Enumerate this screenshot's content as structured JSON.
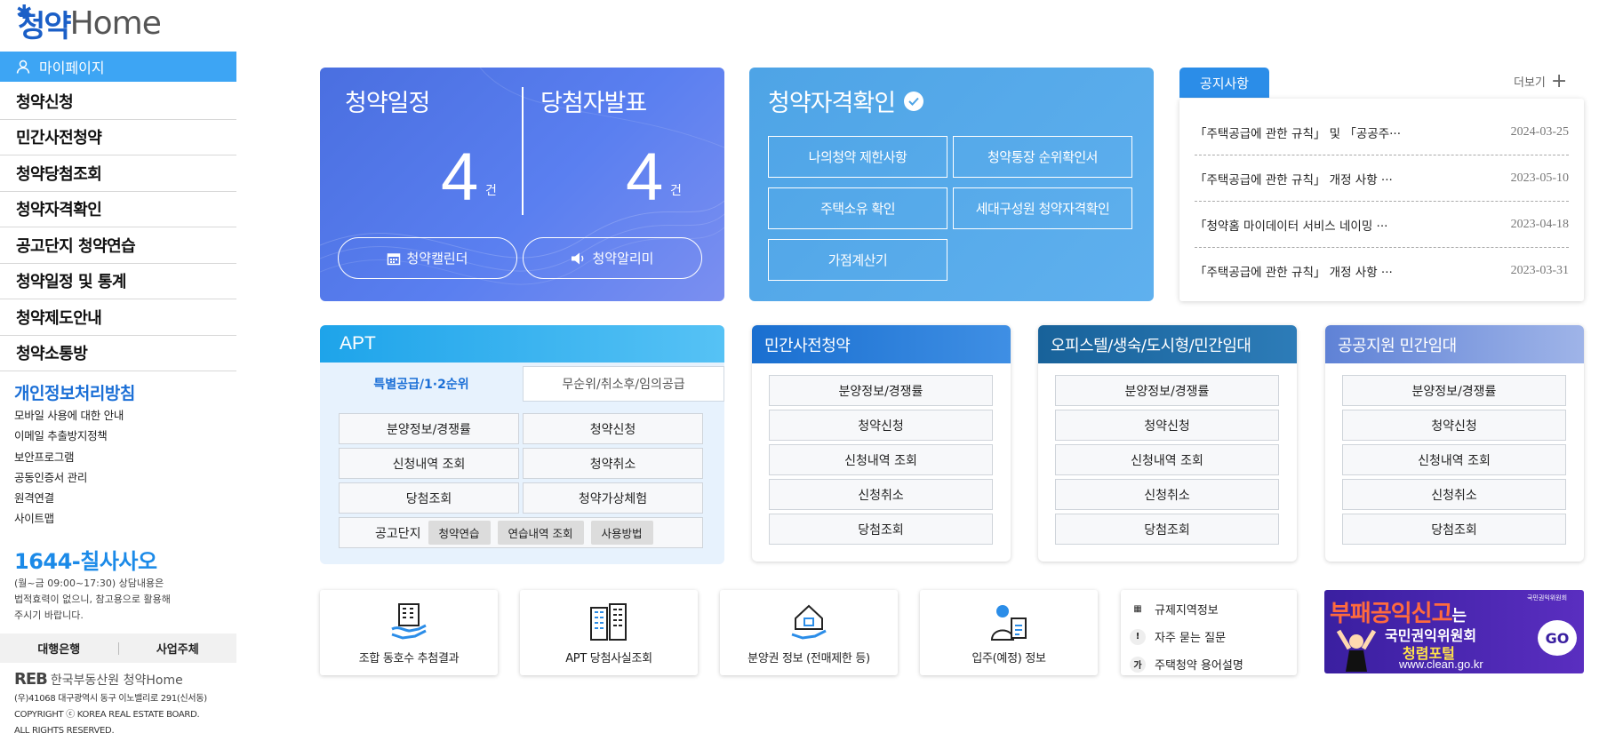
{
  "logo": {
    "ko": "청약",
    "en": "Home"
  },
  "sidebar": {
    "mypage": "마이페이지",
    "nav": [
      "청약신청",
      "민간사전청약",
      "청약당첨조회",
      "청약자격확인",
      "공고단지 청약연습",
      "청약일정 및 통계",
      "청약제도안내",
      "청약소통방"
    ],
    "privacy_title": "개인정보처리방침",
    "links": [
      "모바일 사용에 대한 안내",
      "이메일 추출방지정책",
      "보안프로그램",
      "공동인증서 관리",
      "원격연결",
      "사이트맵"
    ],
    "phone": "1644-칠사사오",
    "phone_note": [
      "(월~금 09:00~17:30) 상담내용은",
      "법적효력이 없으니, 참고용으로 활용해",
      "주시기 바랍니다."
    ],
    "bank": "대행은행",
    "business": "사업주체",
    "reb_logo": "REB",
    "reb_text": "한국부동산원 청약Home",
    "address": [
      "(우)41068 대구광역시 동구 이노밸리로 291(신서동)",
      "COPYRIGHT ⓒ KOREA REAL ESTATE BOARD.",
      "ALL RIGHTS RESERVED."
    ]
  },
  "schedule": {
    "title_left": "청약일정",
    "title_right": "당첨자발표",
    "count_left": "4",
    "count_right": "4",
    "unit": "건",
    "calendar_btn": "청약캘린더",
    "alarm_btn": "청약알리미"
  },
  "qualification": {
    "title": "청약자격확인",
    "buttons": [
      "나의청약 제한사항",
      "청약통장 순위확인서",
      "주택소유 확인",
      "세대구성원 청약자격확인",
      "가점계산기"
    ]
  },
  "notice": {
    "tab": "공지사항",
    "more": "더보기",
    "items": [
      {
        "title": "「주택공급에 관한 규칙」 및 「공공주···",
        "date": "2024-03-25"
      },
      {
        "title": "「주택공급에 관한 규칙」 개정 사항 ···",
        "date": "2023-05-10"
      },
      {
        "title": "「청약홈 마이데이터 서비스 네이밍 ···",
        "date": "2023-04-18"
      },
      {
        "title": "「주택공급에 관한 규칙」 개정 사항 ···",
        "date": "2023-03-31"
      }
    ]
  },
  "apt": {
    "title": "APT",
    "tab_active": "특별공급/1·2순위",
    "tab_inactive": "무순위/취소후/임의공급",
    "buttons": [
      "분양정보/경쟁률",
      "청약신청",
      "신청내역 조회",
      "청약취소",
      "당첨조회",
      "청약가상체험"
    ],
    "practice_label": "공고단지",
    "practice_chips": [
      "청약연습",
      "연습내역 조회",
      "사용방법"
    ]
  },
  "panels": [
    {
      "title": "민간사전청약",
      "buttons": [
        "분양정보/경쟁률",
        "청약신청",
        "신청내역 조회",
        "신청취소",
        "당첨조회"
      ]
    },
    {
      "title": "오피스텔/생숙/도시형/민간임대",
      "buttons": [
        "분양정보/경쟁률",
        "청약신청",
        "신청내역 조회",
        "신청취소",
        "당첨조회"
      ]
    },
    {
      "title": "공공지원 민간임대",
      "buttons": [
        "분양정보/경쟁률",
        "청약신청",
        "신청내역 조회",
        "신청취소",
        "당첨조회"
      ]
    }
  ],
  "quick": [
    "조합 동호수 추첨결과",
    "APT 당첨사실조회",
    "분양권 정보 (전매제한 등)",
    "입주(예정) 정보"
  ],
  "mini": [
    "규제지역정보",
    "자주 묻는 질문",
    "주택청약 용어설명"
  ],
  "banner": {
    "title": "부패공익신고",
    "suffix": "는",
    "org": "국민권익위원회",
    "portal": "청렴포털",
    "url": "www.clean.go.kr",
    "go": "GO",
    "badge": "국민권익위원회"
  },
  "colors": {
    "accent": "#3da5f4",
    "schedule": "#4a6fe0",
    "qualification": "#4ea4e6",
    "notice_tab": "#2b8de8"
  }
}
